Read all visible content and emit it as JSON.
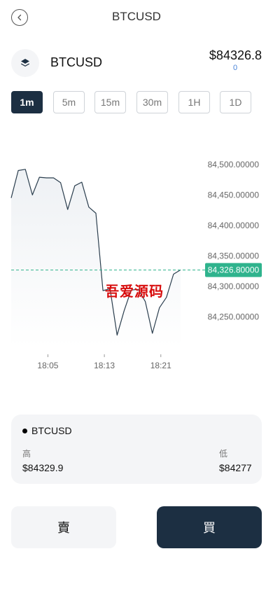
{
  "header": {
    "title": "BTCUSD"
  },
  "symbol": {
    "name": "BTCUSD",
    "price": "$84326.8",
    "change": "0"
  },
  "intervals": [
    {
      "label": "1m",
      "active": true
    },
    {
      "label": "5m",
      "active": false
    },
    {
      "label": "15m",
      "active": false
    },
    {
      "label": "30m",
      "active": false
    },
    {
      "label": "1H",
      "active": false
    },
    {
      "label": "1D",
      "active": false
    }
  ],
  "watermark": "吾爱源码",
  "colors": {
    "accent": "#1c2f42",
    "current_price": "#2fb38d",
    "line": "#2b3e4e",
    "area": "#eef1f4"
  },
  "chart_data": {
    "type": "area",
    "x": [
      1,
      2,
      3,
      4,
      5,
      6,
      7,
      8,
      9,
      10,
      11,
      12,
      13,
      14,
      15,
      16,
      17,
      18,
      19,
      20,
      21,
      22,
      23,
      24,
      25
    ],
    "values": [
      84445,
      84490,
      84492,
      84450,
      84479,
      84478,
      84478,
      84470,
      84426,
      84465,
      84471,
      84430,
      84420,
      84293,
      84296,
      84220,
      84260,
      84294,
      84295,
      84275,
      84223,
      84265,
      84282,
      84320,
      84327
    ],
    "x_ticks": [
      {
        "x": 6.2,
        "label": "18:05"
      },
      {
        "x": 14.2,
        "label": "18:13"
      },
      {
        "x": 22.2,
        "label": "18:21"
      }
    ],
    "y_ticks": [
      {
        "y": 84500,
        "label": "84,500.00000"
      },
      {
        "y": 84450,
        "label": "84,450.00000"
      },
      {
        "y": 84400,
        "label": "84,400.00000"
      },
      {
        "y": 84350,
        "label": "84,350.00000"
      },
      {
        "y": 84300,
        "label": "84,300.00000"
      },
      {
        "y": 84250,
        "label": "84,250.00000"
      }
    ],
    "current_price": {
      "value": 84326.8,
      "label": "84,326.80000"
    },
    "ylim": [
      84200,
      84540
    ],
    "xlim": [
      1,
      25
    ]
  },
  "card": {
    "title": "BTCUSD",
    "high_label": "高",
    "high_value": "$84329.9",
    "low_label": "低",
    "low_value": "$84277"
  },
  "actions": {
    "sell_label": "賣",
    "buy_label": "買"
  }
}
